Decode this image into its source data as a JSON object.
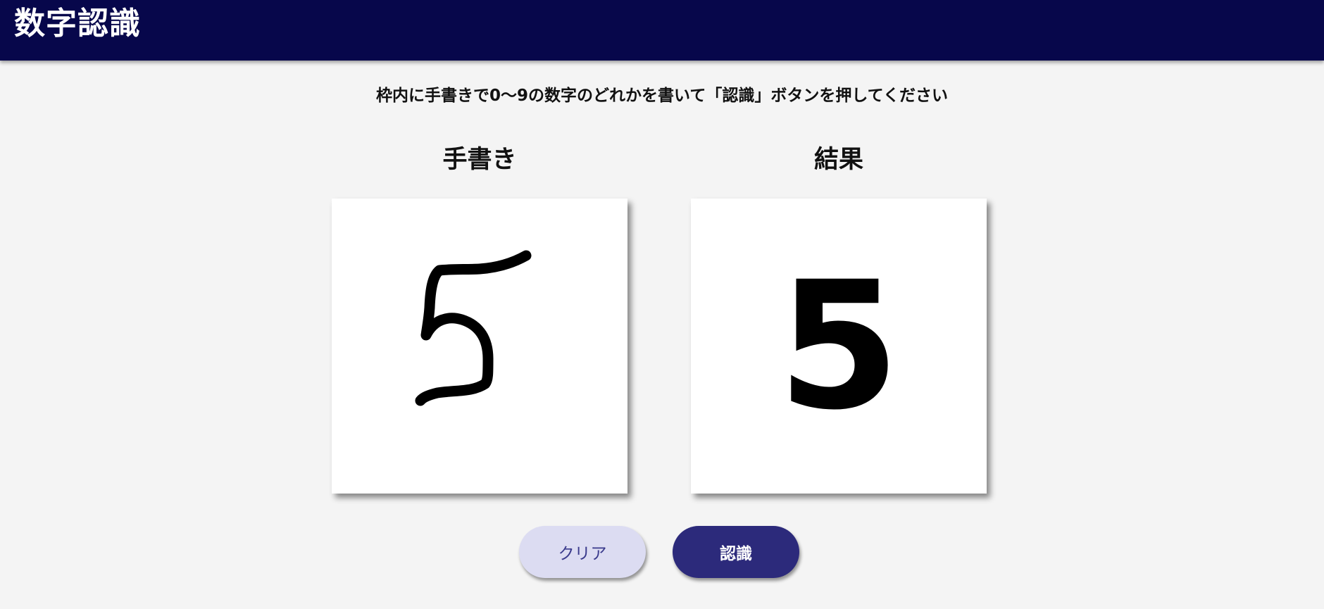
{
  "header": {
    "title": "数字認識"
  },
  "instruction": "枠内に手書きで0～9の数字のどれかを書いて「認識」ボタンを押してください",
  "handwriting_panel": {
    "heading": "手書き",
    "drawn_digit": "5"
  },
  "result_panel": {
    "heading": "結果",
    "value": "5"
  },
  "buttons": {
    "clear_label": "クリア",
    "recognize_label": "認識"
  },
  "colors": {
    "header_bg": "#07074b",
    "clear_button_bg": "#dcdcf2",
    "recognize_button_bg": "#2c2a7b",
    "page_bg": "#f4f4f4"
  }
}
